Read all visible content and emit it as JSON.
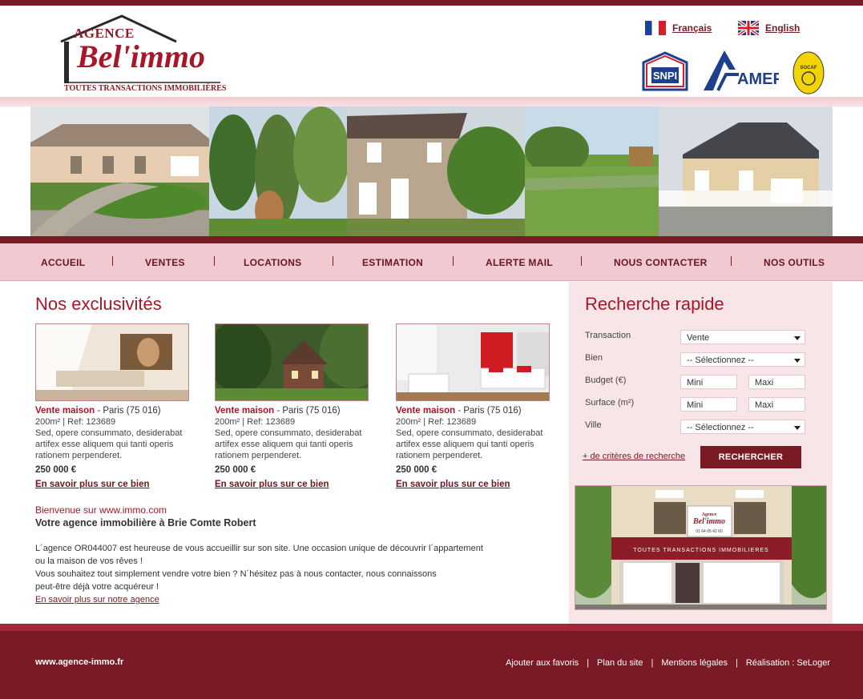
{
  "header": {
    "logo": {
      "line1": "AGENCE",
      "line2": "Bel'immo",
      "tagline": "TOUTES TRANSACTIONS IMMOBILIÈRES"
    },
    "languages": [
      {
        "label": "Français",
        "flag": "flag-fr-icon"
      },
      {
        "label": "English",
        "flag": "flag-uk-icon"
      }
    ],
    "partners": [
      "SNPI",
      "AMEPI",
      "SOCAF"
    ]
  },
  "nav": {
    "items": [
      "ACCUEIL",
      "VENTES",
      "LOCATIONS",
      "ESTIMATION",
      "ALERTE MAIL",
      "NOUS CONTACTER",
      "NOS OUTILS"
    ],
    "separator": "|"
  },
  "exclusives": {
    "title": "Nos exclusivités",
    "listings": [
      {
        "type": "Vente maison",
        "location": " - Paris (75 016)",
        "specs": "200m² | Ref: 123689",
        "description": "Sed, opere consummato, desiderabat artifex esse aliquem qui tanti operis rationem perpenderet.",
        "price": "250 000 €",
        "link": "En savoir plus sur ce bien"
      },
      {
        "type": "Vente maison",
        "location": " - Paris (75 016)",
        "specs": "200m² | Ref: 123689",
        "description": "Sed, opere consummato, desiderabat artifex esse aliquem qui tanti operis rationem perpenderet.",
        "price": "250 000 €",
        "link": "En savoir plus sur ce bien"
      },
      {
        "type": "Vente maison",
        "location": " - Paris (75 016)",
        "specs": "200m² | Ref: 123689",
        "description": "Sed, opere consummato, desiderabat artifex esse aliquem qui tanti operis rationem perpenderet.",
        "price": "250 000 €",
        "link": "En savoir plus sur ce bien"
      }
    ]
  },
  "welcome": {
    "line1": "Bienvenue sur www.immo.com",
    "line2": "Votre agence immobilière à Brie Comte Robert",
    "p1": "L´agence OR044007 est heureuse de vous accueillir sur son site. Une occasion unique de découvrir l´appartement",
    "p2": "ou la maison de vos rêves !",
    "p3": "Vous souhaitez tout simplement vendre votre bien ? N´hésitez pas à nous contacter, nous connaissons",
    "p4": "peut-être déjà votre acquéreur !",
    "link": "En savoir plus sur notre agence"
  },
  "search": {
    "title": "Recherche rapide",
    "fields": {
      "transaction_label": "Transaction",
      "transaction_value": "Vente",
      "bien_label": "Bien",
      "bien_value": "-- Sélectionnez --",
      "budget_label": "Budget (€)",
      "budget_min": "Mini",
      "budget_max": "Maxi",
      "surface_label": "Surface (m²)",
      "surface_min": "Mini",
      "surface_max": "Maxi",
      "ville_label": "Ville",
      "ville_value": "-- Sélectionnez --"
    },
    "more_criteria": "+ de critères de recherche",
    "submit": "RECHERCHER"
  },
  "storefront": {
    "sign_top": "Agence",
    "sign_brand": "Bel'immo",
    "phone": "01 64 05 42 60",
    "awning": "TOUTES TRANSACTIONS IMMOBILIERES"
  },
  "footer": {
    "site": "www.agence-immo.fr",
    "links": [
      "Ajouter aux favoris",
      "Plan du site",
      "Mentions légales",
      "Réalisation : SeLoger"
    ],
    "separator": "|"
  },
  "colors": {
    "brand": "#7a1a24",
    "accent": "#a8162a",
    "nav_bg": "#f1c9d1",
    "sidebar_bg": "#f8e5e8"
  }
}
